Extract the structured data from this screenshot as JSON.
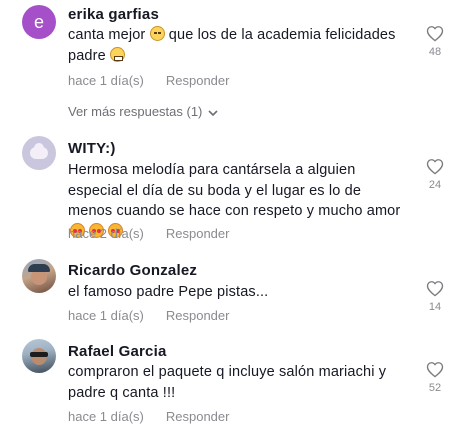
{
  "comments": [
    {
      "author": "erika garfias",
      "avatar_letter": "e",
      "text_parts": [
        "canta mejor ",
        " que los de la academia felicidades padre "
      ],
      "time": "hace 1 día(s)",
      "reply_label": "Responder",
      "likes": "48"
    },
    {
      "author": "WITY:)",
      "text": "Hermosa melodía para cantársela a alguien especial el día de su boda y el lugar es lo de menos cuando se hace con respeto y mucho amor",
      "time": "hace 2 día(s)",
      "reply_label": "Responder",
      "likes": "24"
    },
    {
      "author": "Ricardo Gonzalez",
      "text": "el famoso padre Pepe pistas...",
      "time": "hace 1 día(s)",
      "reply_label": "Responder",
      "likes": "14"
    },
    {
      "author": "Rafael Garcia",
      "text": "compraron el paquete q incluye salón mariachi y padre q canta !!!",
      "time": "hace 1 día(s)",
      "reply_label": "Responder",
      "likes": "52"
    }
  ],
  "view_more_replies": "Ver más respuestas (1)",
  "icons": {
    "like": "heart-outline-icon",
    "expand": "chevron-down-icon"
  },
  "colors": {
    "text": "#161823",
    "muted": "#8a8b91",
    "avatar_letter_bg": "#a550c9"
  }
}
